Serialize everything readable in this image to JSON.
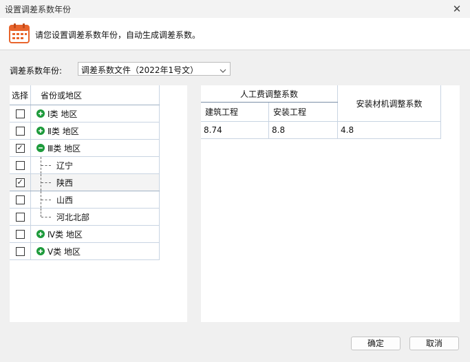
{
  "window": {
    "title": "设置调差系数年份"
  },
  "header": {
    "message": "请您设置调差系数年份，自动生成调差系数。"
  },
  "year": {
    "label": "调差系数年份:",
    "selected": "调差系数文件（2022年1号文）"
  },
  "tree": {
    "col_select": "选择",
    "col_region": "省份或地区",
    "rows": [
      {
        "label": "Ⅰ类 地区",
        "checked": false,
        "level": 0,
        "toggle": "expand"
      },
      {
        "label": "Ⅱ类 地区",
        "checked": false,
        "level": 0,
        "toggle": "expand"
      },
      {
        "label": "Ⅲ类 地区",
        "checked": true,
        "level": 0,
        "toggle": "collapse"
      },
      {
        "label": "辽宁",
        "checked": false,
        "level": 1
      },
      {
        "label": "陕西",
        "checked": true,
        "level": 1,
        "selected": true
      },
      {
        "label": "山西",
        "checked": false,
        "level": 1
      },
      {
        "label": "河北北部",
        "checked": false,
        "level": 1,
        "last": true
      },
      {
        "label": "Ⅳ类 地区",
        "checked": false,
        "level": 0,
        "toggle": "expand"
      },
      {
        "label": "Ⅴ类 地区",
        "checked": false,
        "level": 0,
        "toggle": "expand"
      }
    ]
  },
  "coef": {
    "labor_group": "人工费调整系数",
    "building": "建筑工程",
    "install": "安装工程",
    "material": "安装材机调整系数",
    "values": {
      "building": "8.74",
      "install": "8.8",
      "material": "4.8"
    }
  },
  "buttons": {
    "ok": "确定",
    "cancel": "取消"
  },
  "colors": {
    "toggle_green": "#1e9b3c",
    "calendar_orange": "#e8642c",
    "grid_line": "#c8d4e2"
  }
}
